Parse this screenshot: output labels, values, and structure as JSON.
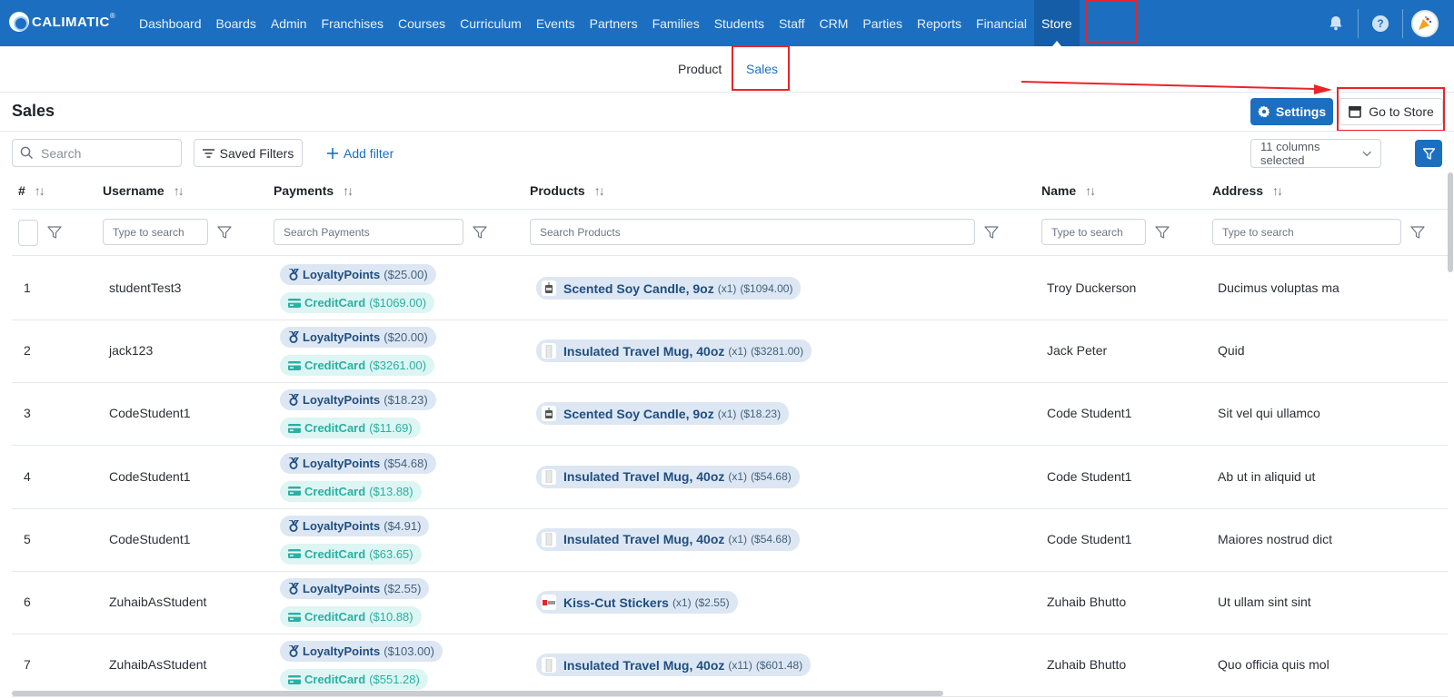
{
  "brand": {
    "name": "CALIMATIC",
    "reg": "®"
  },
  "nav": {
    "items": [
      {
        "label": "Dashboard"
      },
      {
        "label": "Boards"
      },
      {
        "label": "Admin"
      },
      {
        "label": "Franchises"
      },
      {
        "label": "Courses"
      },
      {
        "label": "Curriculum"
      },
      {
        "label": "Events"
      },
      {
        "label": "Partners"
      },
      {
        "label": "Families"
      },
      {
        "label": "Students"
      },
      {
        "label": "Staff"
      },
      {
        "label": "CRM"
      },
      {
        "label": "Parties"
      },
      {
        "label": "Reports"
      },
      {
        "label": "Financial"
      },
      {
        "label": "Store"
      }
    ],
    "active": "Store",
    "help_glyph": "?"
  },
  "subtabs": {
    "product": "Product",
    "sales": "Sales",
    "active": "Sales"
  },
  "page": {
    "title": "Sales",
    "settings_label": "Settings",
    "go_to_store_label": "Go to Store"
  },
  "filters": {
    "search_placeholder": "Search",
    "saved_filters_label": "Saved Filters",
    "add_filter_label": "Add filter",
    "columns_selected": "11 columns selected"
  },
  "table": {
    "columns": {
      "num": "#",
      "username": "Username",
      "payments": "Payments",
      "products": "Products",
      "name": "Name",
      "address": "Address"
    },
    "search_placeholders": {
      "username": "Type to search",
      "payments": "Search Payments",
      "products": "Search Products",
      "name": "Type to search",
      "address": "Type to search"
    },
    "rows": [
      {
        "num": "1",
        "username": "studentTest3",
        "payments": [
          {
            "method": "LoyaltyPoints",
            "amount": "($25.00)"
          },
          {
            "method": "CreditCard",
            "amount": "($1069.00)"
          }
        ],
        "product": {
          "name": "Scented Soy Candle, 9oz",
          "qty": "(x1)",
          "amount": "($1094.00)",
          "thumb": "candle"
        },
        "name": "Troy Duckerson",
        "address": "Ducimus voluptas ma"
      },
      {
        "num": "2",
        "username": "jack123",
        "payments": [
          {
            "method": "LoyaltyPoints",
            "amount": "($20.00)"
          },
          {
            "method": "CreditCard",
            "amount": "($3261.00)"
          }
        ],
        "product": {
          "name": "Insulated Travel Mug, 40oz",
          "qty": "(x1)",
          "amount": "($3281.00)",
          "thumb": "mug"
        },
        "name": "Jack Peter",
        "address": "Quid"
      },
      {
        "num": "3",
        "username": "CodeStudent1",
        "payments": [
          {
            "method": "LoyaltyPoints",
            "amount": "($18.23)"
          },
          {
            "method": "CreditCard",
            "amount": "($11.69)"
          }
        ],
        "product": {
          "name": "Scented Soy Candle, 9oz",
          "qty": "(x1)",
          "amount": "($18.23)",
          "thumb": "candle"
        },
        "name": "Code Student1",
        "address": "Sit vel qui ullamco"
      },
      {
        "num": "4",
        "username": "CodeStudent1",
        "payments": [
          {
            "method": "LoyaltyPoints",
            "amount": "($54.68)"
          },
          {
            "method": "CreditCard",
            "amount": "($13.88)"
          }
        ],
        "product": {
          "name": "Insulated Travel Mug, 40oz",
          "qty": "(x1)",
          "amount": "($54.68)",
          "thumb": "mug"
        },
        "name": "Code Student1",
        "address": "Ab ut in aliquid ut"
      },
      {
        "num": "5",
        "username": "CodeStudent1",
        "payments": [
          {
            "method": "LoyaltyPoints",
            "amount": "($4.91)"
          },
          {
            "method": "CreditCard",
            "amount": "($63.65)"
          }
        ],
        "product": {
          "name": "Insulated Travel Mug, 40oz",
          "qty": "(x1)",
          "amount": "($54.68)",
          "thumb": "mug"
        },
        "name": "Code Student1",
        "address": "Maiores nostrud dict"
      },
      {
        "num": "6",
        "username": "ZuhaibAsStudent",
        "payments": [
          {
            "method": "LoyaltyPoints",
            "amount": "($2.55)"
          },
          {
            "method": "CreditCard",
            "amount": "($10.88)"
          }
        ],
        "product": {
          "name": "Kiss-Cut Stickers",
          "qty": "(x1)",
          "amount": "($2.55)",
          "thumb": "stickers"
        },
        "name": "Zuhaib Bhutto",
        "address": "Ut ullam sint sint"
      },
      {
        "num": "7",
        "username": "ZuhaibAsStudent",
        "payments": [
          {
            "method": "LoyaltyPoints",
            "amount": "($103.00)"
          },
          {
            "method": "CreditCard",
            "amount": "($551.28)"
          }
        ],
        "product": {
          "name": "Insulated Travel Mug, 40oz",
          "qty": "(x11)",
          "amount": "($601.48)",
          "thumb": "mug"
        },
        "name": "Zuhaib Bhutto",
        "address": "Quo officia quis mol"
      }
    ]
  },
  "colors": {
    "primary": "#1c6fc0",
    "highlight": "#e8242a",
    "loyalty": "#1f4e80",
    "credit": "#2ab0a3"
  }
}
